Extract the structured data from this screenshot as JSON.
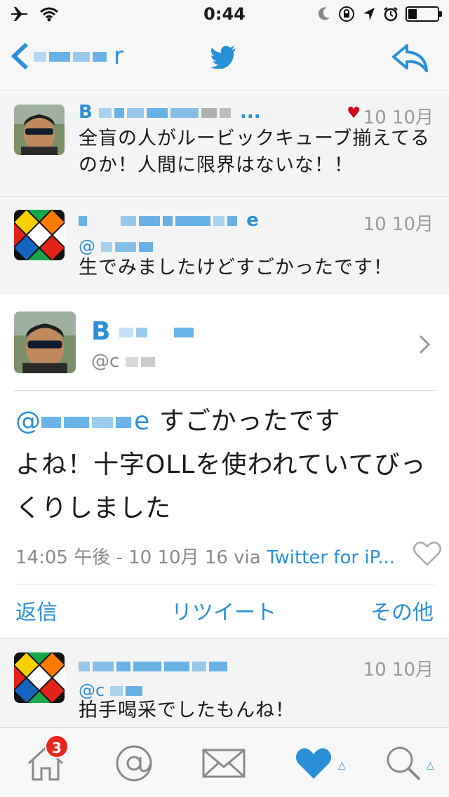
{
  "status_bar": {
    "time": "0:44",
    "battery_level": 0.3
  },
  "nav": {
    "back_label": "r",
    "title_icon": "twitter-bird-icon",
    "reply_icon": "reply-icon"
  },
  "tweets": [
    {
      "name": "B",
      "name_suffix": "...",
      "date": "10 10月",
      "favorited": true,
      "text": "全盲の人がルービックキューブ揃えてるのか！人間に限界はないな！！",
      "avatar": "person-sunglasses-avatar"
    },
    {
      "name": "",
      "name_end": "e",
      "handle": "@",
      "date": "10 10月",
      "text": "生でみましたけどすごかったです！",
      "avatar": "rubiks-cube-avatar"
    },
    {
      "name": "",
      "handle": "@c",
      "date": "10 10月",
      "text": "拍手喝采でしたもんね！",
      "avatar": "rubiks-cube-avatar"
    }
  ],
  "detail": {
    "name": "B",
    "handle": "@c",
    "mention_prefix": "@",
    "mention_end": "e",
    "text_line1": "すごかったです",
    "text_rest": "よね！十字OLLを使われていてびっくりしました",
    "meta": "14:05 午後 - 10 10月 16 via ",
    "via_link": "Twitter for iP...",
    "actions": {
      "reply": "返信",
      "retweet": "リツイート",
      "more": "その他"
    }
  },
  "tab_bar": {
    "home_badge": "3"
  },
  "colors": {
    "accent": "#2b8fd8",
    "heart": "#d0021b",
    "badge": "#e8261f"
  }
}
